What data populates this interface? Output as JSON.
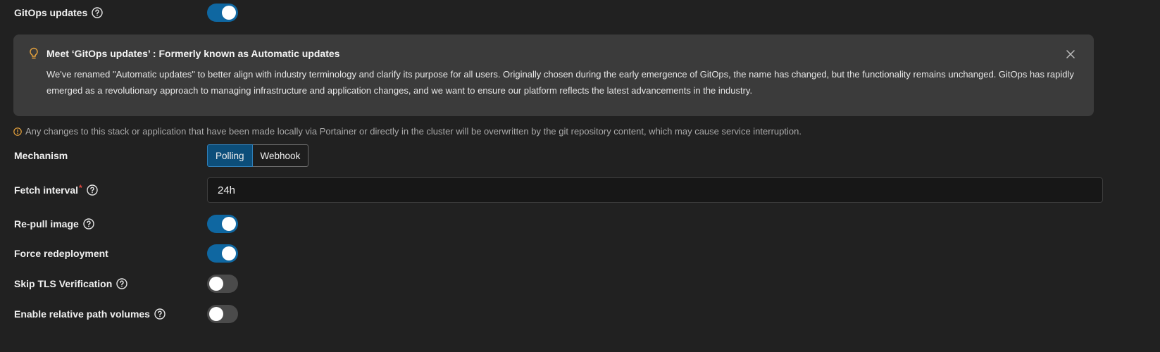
{
  "gitops": {
    "label": "GitOps updates",
    "enabled": true
  },
  "callout": {
    "title": "Meet ‘GitOps updates’ : Formerly known as Automatic updates",
    "body": "We've renamed \"Automatic updates\" to better align with industry terminology and clarify its purpose for all users. Originally chosen during the early emergence of GitOps, the name has changed, but the functionality remains unchanged. GitOps has rapidly emerged as a revolutionary approach to managing infrastructure and application changes, and we want to ensure our platform reflects the latest advancements in the industry.",
    "icon": "lightbulb-icon"
  },
  "warning": {
    "text": "Any changes to this stack or application that have been made locally via Portainer or directly in the cluster will be overwritten by the git repository content, which may cause service interruption.",
    "color": "#e6a23c"
  },
  "mechanism": {
    "label": "Mechanism",
    "options": [
      "Polling",
      "Webhook"
    ],
    "selected": "Polling"
  },
  "fetch_interval": {
    "label": "Fetch interval",
    "required_mark": "*",
    "value": "24h"
  },
  "repull_image": {
    "label": "Re-pull image",
    "enabled": true
  },
  "force_redeployment": {
    "label": "Force redeployment",
    "enabled": true
  },
  "skip_tls": {
    "label": "Skip TLS Verification",
    "enabled": false
  },
  "relative_paths": {
    "label": "Enable relative path volumes",
    "enabled": false
  },
  "colors": {
    "accent": "#0f67a1",
    "toggle_off": "#4b4b4b",
    "required": "#e0473f",
    "background": "#212121",
    "callout_bg": "#3b3b3b"
  }
}
